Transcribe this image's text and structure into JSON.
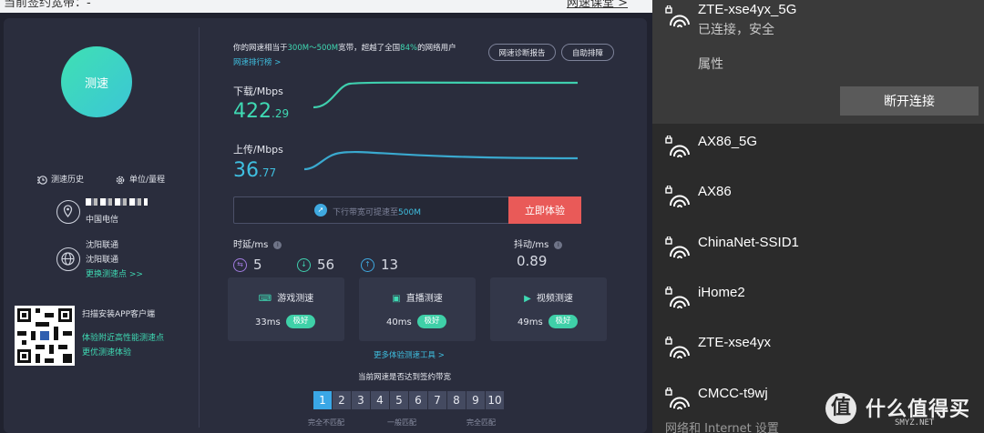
{
  "top_strip": {
    "left_text": "当前签约宽带：-",
    "right_link": "网速课堂 >"
  },
  "speed_test": {
    "start_button": "测速",
    "history_label": "测速历史",
    "unit_label": "单位/量程",
    "isp": {
      "name": "中国电信",
      "server_city": "沈阳联通",
      "server_name": "沈阳联通",
      "change_server": "更换测速点 >>"
    },
    "qr": {
      "title": "扫描安装APP客户端",
      "line1": "体验附近高性能测速点",
      "line2": "更优测速体验"
    },
    "summary": {
      "prefix": "你的网速相当于",
      "range": "300M～500M",
      "middle": "宽带，超越了全国",
      "percent": "84%",
      "suffix": "的网络用户"
    },
    "rank_link": "网速排行榜 >",
    "report_button": "网速诊断报告",
    "troubleshoot_button": "自助排障",
    "download": {
      "label": "下载/Mbps",
      "int": "422",
      "dec": ".29"
    },
    "upload": {
      "label": "上传/Mbps",
      "int": "36",
      "dec": ".77"
    },
    "promo": {
      "text_prefix": "下行带宽可提速至",
      "text_value": "500M",
      "button": "立即体验"
    },
    "latency_label": "时延/ms",
    "jitter_label": "抖动/ms",
    "latency": {
      "idle": "5",
      "down": "56",
      "up": "13"
    },
    "jitter": "0.89",
    "tests": [
      {
        "name": "游戏测速",
        "ms": "33ms",
        "tag": "极好"
      },
      {
        "name": "直播测速",
        "ms": "40ms",
        "tag": "极好"
      },
      {
        "name": "视频测速",
        "ms": "49ms",
        "tag": "极好"
      }
    ],
    "more_tools": "更多体验测速工具 >",
    "compare_title": "当前网速是否达到签约带宽",
    "scale": [
      "1",
      "2",
      "3",
      "4",
      "5",
      "6",
      "7",
      "8",
      "9",
      "10"
    ],
    "scale_selected": "1",
    "scale_labels": {
      "low": "完全不匹配",
      "mid": "一般匹配",
      "high": "完全匹配"
    },
    "colors": {
      "accent_green": "#3fd9b3",
      "accent_blue": "#3fbfe0",
      "download_line": "#3fcfae",
      "upload_line": "#3aa9cf",
      "promo_button": "#e95a58"
    }
  },
  "wifi": {
    "connected": {
      "name": "ZTE-xse4yx_5G",
      "status": "已连接，安全",
      "properties": "属性",
      "disconnect": "断开连接"
    },
    "networks": [
      "AX86_5G",
      "AX86",
      "ChinaNet-SSID1",
      "iHome2",
      "ZTE-xse4yx",
      "CMCC-t9wj"
    ],
    "settings_link": "网络和 Internet 设置",
    "icon": "wifi-secured-icon"
  },
  "watermark": {
    "glyph": "值",
    "text": "什么值得买",
    "sub": "SMYZ.NET"
  }
}
